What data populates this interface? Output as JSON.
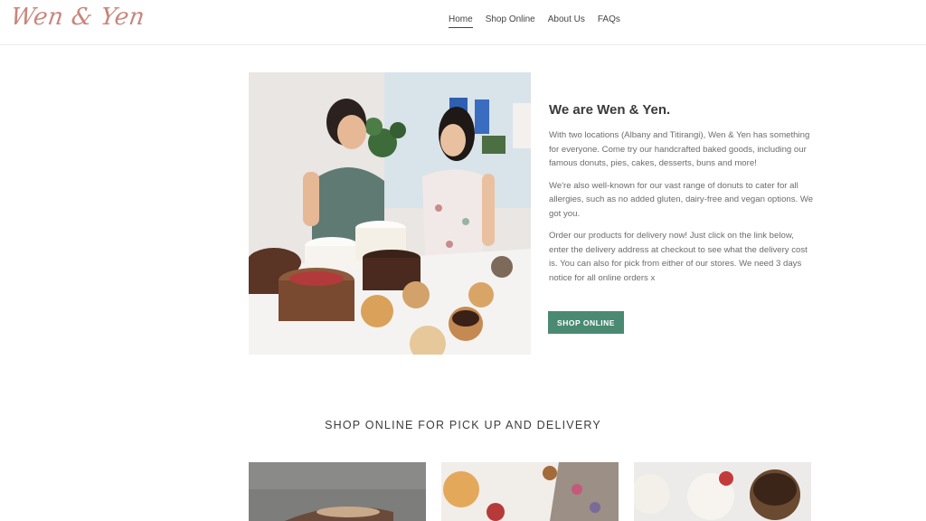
{
  "brand": {
    "logo_text": "Wen & Yen"
  },
  "nav": {
    "items": [
      {
        "label": "Home",
        "active": true
      },
      {
        "label": "Shop Online",
        "active": false
      },
      {
        "label": "About Us",
        "active": false
      },
      {
        "label": "FAQs",
        "active": false
      }
    ]
  },
  "intro": {
    "heading": "We are Wen & Yen.",
    "paragraphs": [
      "With two locations (Albany and Titirangi), Wen & Yen has something for everyone. Come try our handcrafted baked goods, including our famous donuts, pies, cakes, desserts, buns and more!",
      "We're also well-known for our vast range of donuts to cater for all allergies, such as no added gluten, dairy-free and vegan options. We got you.",
      "Order our products for delivery now! Just click on the link below, enter the delivery address at checkout to see what the delivery cost is. You can also for pick from either of our stores. We need 3 days notice for all online orders x"
    ],
    "cta_label": "SHOP ONLINE",
    "cta_color": "#4b8a72"
  },
  "shop_section": {
    "title": "SHOP ONLINE FOR PICK UP AND DELIVERY"
  },
  "colors": {
    "logo": "#c9867c",
    "accent": "#4b8a72"
  }
}
